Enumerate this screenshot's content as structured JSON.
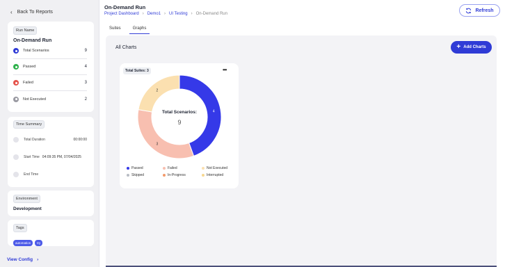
{
  "sidebar": {
    "back_label": "Back To Reports",
    "run_name_chip": "Run Name",
    "run_name": "On-Demand Run",
    "stats": [
      {
        "label": "Total Scenarios",
        "count": "9",
        "color": "#2f3bd6"
      },
      {
        "label": "Passed",
        "count": "4",
        "color": "#2fb24c"
      },
      {
        "label": "Failed",
        "count": "3",
        "color": "#e5534b"
      },
      {
        "label": "Not Executed",
        "count": "2",
        "color": "#9a9aa2"
      }
    ],
    "time_summary_chip": "Time Summary",
    "times": [
      {
        "label": "Total Duration",
        "value": "00:00:00"
      },
      {
        "label": "Start Time",
        "value": "04:09:35 PM, 07/04/2025"
      },
      {
        "label": "End Time",
        "value": ""
      }
    ],
    "environment_chip": "Environment",
    "environment": "Development",
    "tags_chip": "Tags",
    "tags": [
      "automation",
      "try"
    ],
    "view_config": "View Config"
  },
  "header": {
    "title": "On-Demand Run",
    "breadcrumb": [
      "Project Dashboard",
      "Demo1",
      "UI Testing",
      "On-Demand Run"
    ],
    "refresh_label": "Refresh"
  },
  "tabs": [
    {
      "label": "Suites",
      "active": false
    },
    {
      "label": "Graphs",
      "active": true
    }
  ],
  "main": {
    "all_charts_label": "All Charts",
    "add_charts_label": "Add Charts"
  },
  "chart_card": {
    "total_suites": "Total Suites: 3",
    "menu": "•••",
    "center_label": "Total Scenarios:",
    "center_value": "9"
  },
  "chart_data": {
    "type": "pie",
    "title": "Total Scenarios:",
    "total": 9,
    "slices": [
      {
        "label": "Passed",
        "value": 4,
        "color": "#3539e8"
      },
      {
        "label": "Failed",
        "value": 3,
        "color": "#f8bfb0"
      },
      {
        "label": "Not Executed",
        "value": 2,
        "color": "#fbe0b0"
      }
    ],
    "legend": [
      {
        "label": "Passed",
        "color": "#3539e8"
      },
      {
        "label": "Failed",
        "color": "#f8bfb0"
      },
      {
        "label": "Not Executed",
        "color": "#fbe0b0"
      },
      {
        "label": "Skipped",
        "color": "#b8bcc4"
      },
      {
        "label": "In-Progress",
        "color": "#f39a6b"
      },
      {
        "label": "Interrupted",
        "color": "#f7d890"
      }
    ],
    "legend_position": "bottom"
  }
}
